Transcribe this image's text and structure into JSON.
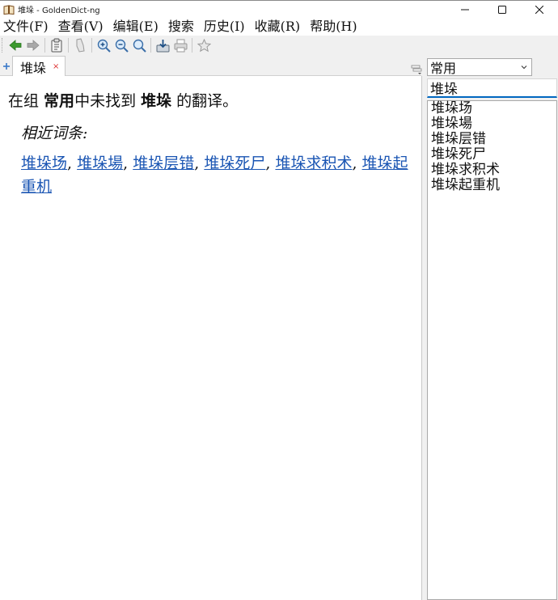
{
  "window": {
    "title": "堆垛 - GoldenDict-ng",
    "app_icon": "book-icon"
  },
  "menu": [
    "文件(F)",
    "查看(V)",
    "编辑(E)",
    "搜索",
    "历史(I)",
    "收藏(R)",
    "帮助(H)"
  ],
  "toolbar": {
    "icons": [
      "back-arrow-icon",
      "forward-arrow-icon",
      "clipboard-icon",
      "pronounce-icon",
      "zoom-in-icon",
      "zoom-out-icon",
      "zoom-reset-icon",
      "save-article-icon",
      "print-icon",
      "favorite-star-icon"
    ]
  },
  "tabs": [
    {
      "label": "堆垛",
      "close": "×"
    }
  ],
  "article": {
    "prefix": "在组 ",
    "group": "常用",
    "middle": "中未找到 ",
    "word": "堆垛",
    "suffix": " 的翻译。",
    "similar_heading": "相近词条:",
    "similar_words": [
      "堆垛场",
      "堆垛場",
      "堆垛层错",
      "堆垛死尸",
      "堆垛求积术",
      "堆垛起重机"
    ]
  },
  "sidebar": {
    "group_selected": "常用",
    "search_value": "堆垛",
    "word_list": [
      "堆垛场",
      "堆垛場",
      "堆垛层错",
      "堆垛死尸",
      "堆垛求积术",
      "堆垛起重机"
    ]
  },
  "colors": {
    "link": "#1a55b3",
    "accent": "#0067c0",
    "back_arrow": "#3c9a2e"
  }
}
